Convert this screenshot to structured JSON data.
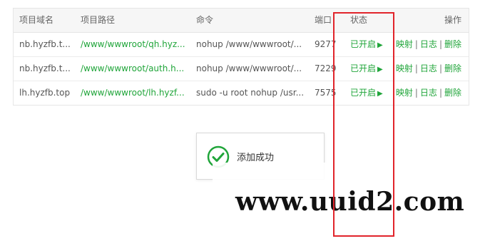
{
  "table": {
    "headers": {
      "domain": "项目域名",
      "path": "项目路径",
      "command": "命令",
      "port": "端口",
      "status": "状态",
      "actions": "操作"
    },
    "rows": [
      {
        "domain": "nb.hyzfb.t...",
        "path": "/www/wwwroot/qh.hyz...",
        "command": "nohup /www/wwwroot/...",
        "port": "9277",
        "status": "已开启",
        "status_icon": "play-icon",
        "actions": {
          "map": "映射",
          "log": "日志",
          "delete": "删除"
        }
      },
      {
        "domain": "nb.hyzfb.t...",
        "path": "/www/wwwroot/auth.h...",
        "command": "nohup /www/wwwroot/...",
        "port": "7229",
        "status": "已开启",
        "status_icon": "play-icon",
        "actions": {
          "map": "映射",
          "log": "日志",
          "delete": "删除"
        }
      },
      {
        "domain": "lh.hyzfb.top",
        "path": "/www/wwwroot/lh.hyzf...",
        "command": "sudo -u root nohup /usr...",
        "port": "7575",
        "status": "已开启",
        "status_icon": "play-icon",
        "actions": {
          "map": "映射",
          "log": "日志",
          "delete": "删除"
        }
      }
    ],
    "separator": "|",
    "play_glyph": "▶"
  },
  "toast": {
    "message": "添加成功",
    "icon": "check-circle-icon"
  },
  "watermark": {
    "text": "www.uuid2.com"
  },
  "colors": {
    "accent_green": "#20a53a",
    "highlight_red": "#e1242b"
  }
}
